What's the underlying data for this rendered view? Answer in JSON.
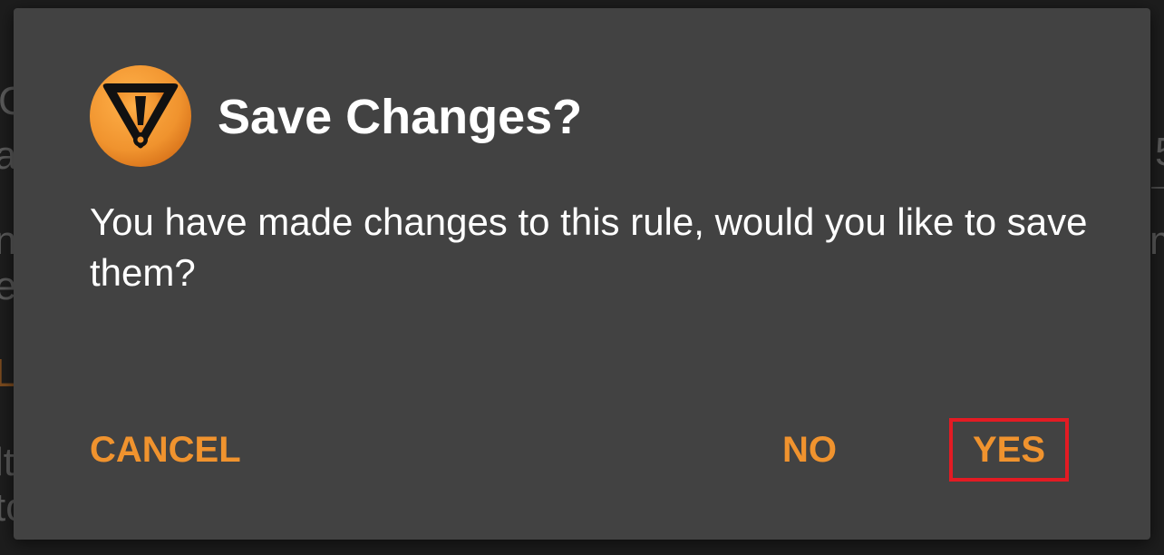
{
  "dialog": {
    "icon": "warning-triangle-icon",
    "title": "Save Changes?",
    "message": "You have made changes to this rule, would you like to save them?",
    "buttons": {
      "cancel": "CANCEL",
      "no": "NO",
      "yes": "YES"
    },
    "highlighted_button": "yes"
  },
  "background": {
    "fragments": [
      "C",
      "a",
      "n",
      "er",
      "L",
      "lt",
      "to",
      "5",
      "m"
    ]
  },
  "colors": {
    "dialog_bg": "#424242",
    "accent": "#f0932e",
    "icon_orange": "#f0932e",
    "highlight": "#e31b23",
    "text": "#ffffff"
  }
}
